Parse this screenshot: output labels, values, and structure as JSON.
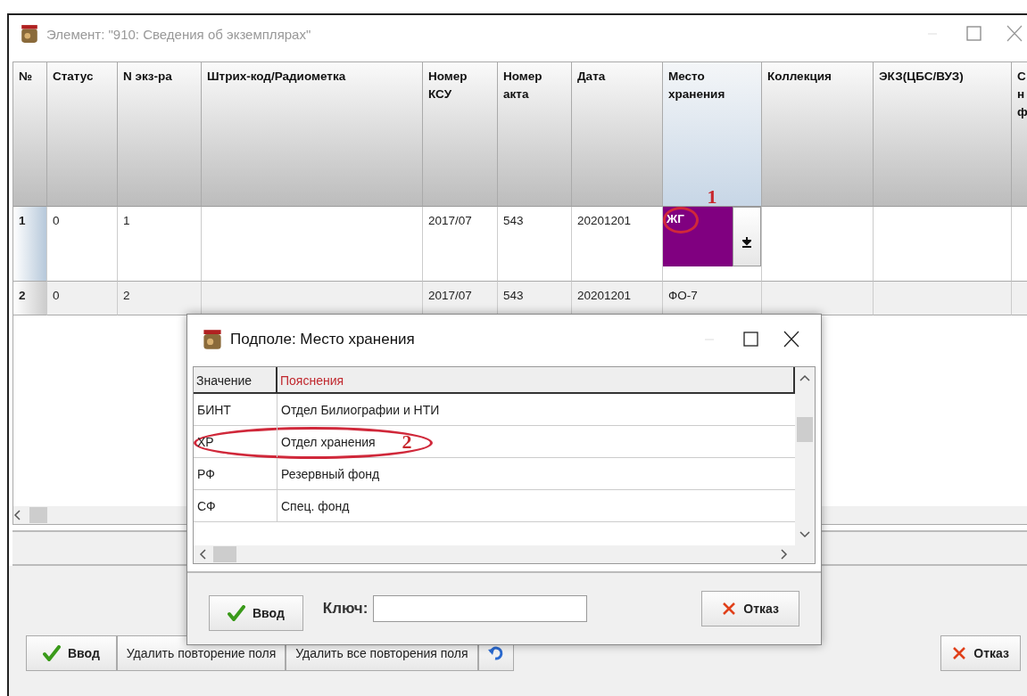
{
  "window": {
    "title": "Элемент:  \"910: Сведения об экземплярах\""
  },
  "table": {
    "columns": [
      {
        "lines": [
          "№"
        ],
        "selected": false
      },
      {
        "lines": [
          "Статус"
        ],
        "selected": false
      },
      {
        "lines": [
          "N экз-ра"
        ],
        "selected": false
      },
      {
        "lines": [
          "Штрих-код/Радиометка"
        ],
        "selected": false
      },
      {
        "lines": [
          "Номер",
          "КСУ"
        ],
        "selected": false
      },
      {
        "lines": [
          "Номер",
          "акта"
        ],
        "selected": false
      },
      {
        "lines": [
          "Дата"
        ],
        "selected": false
      },
      {
        "lines": [
          "Место",
          "хранения"
        ],
        "selected": true
      },
      {
        "lines": [
          "Коллекция"
        ],
        "selected": false
      },
      {
        "lines": [
          "ЭКЗ(ЦБС/ВУЗ)"
        ],
        "selected": false
      },
      {
        "lines": [
          "С",
          "н",
          "ф"
        ],
        "selected": false
      }
    ],
    "rows": [
      {
        "current": true,
        "cells": [
          "1",
          "0",
          "1",
          "",
          "2017/07",
          "543",
          "20201201",
          "ЖГ",
          "",
          "",
          ""
        ]
      },
      {
        "current": false,
        "cells": [
          "2",
          "0",
          "2",
          "",
          "2017/07",
          "543",
          "20201201",
          "ФО-7",
          "",
          "",
          ""
        ]
      }
    ],
    "annotation": "1"
  },
  "popup": {
    "title": "Подполе: Место хранения",
    "columns": [
      {
        "label": "Значение",
        "selected": false
      },
      {
        "label": "Пояснения",
        "selected": true
      }
    ],
    "rows": [
      {
        "code": "БИНТ",
        "text": "Отдел Билиографии и НТИ",
        "circled": false
      },
      {
        "code": "ХР",
        "text": "Отдел хранения",
        "circled": true
      },
      {
        "code": "РФ",
        "text": "Резервный фонд",
        "circled": false
      },
      {
        "code": "СФ",
        "text": "Спец. фонд",
        "circled": false
      }
    ],
    "annotation": "2",
    "ok": "Ввод",
    "key_label": "Ключ:",
    "cancel": "Отказ"
  },
  "buttons": [
    {
      "kind": "ok",
      "label": "Ввод"
    },
    {
      "kind": "text",
      "label": "Удалить повторение поля"
    },
    {
      "kind": "text",
      "label": "Удалить все повторения поля"
    },
    {
      "kind": "undo"
    },
    {
      "kind": "cancel",
      "label": "Отказ"
    }
  ]
}
